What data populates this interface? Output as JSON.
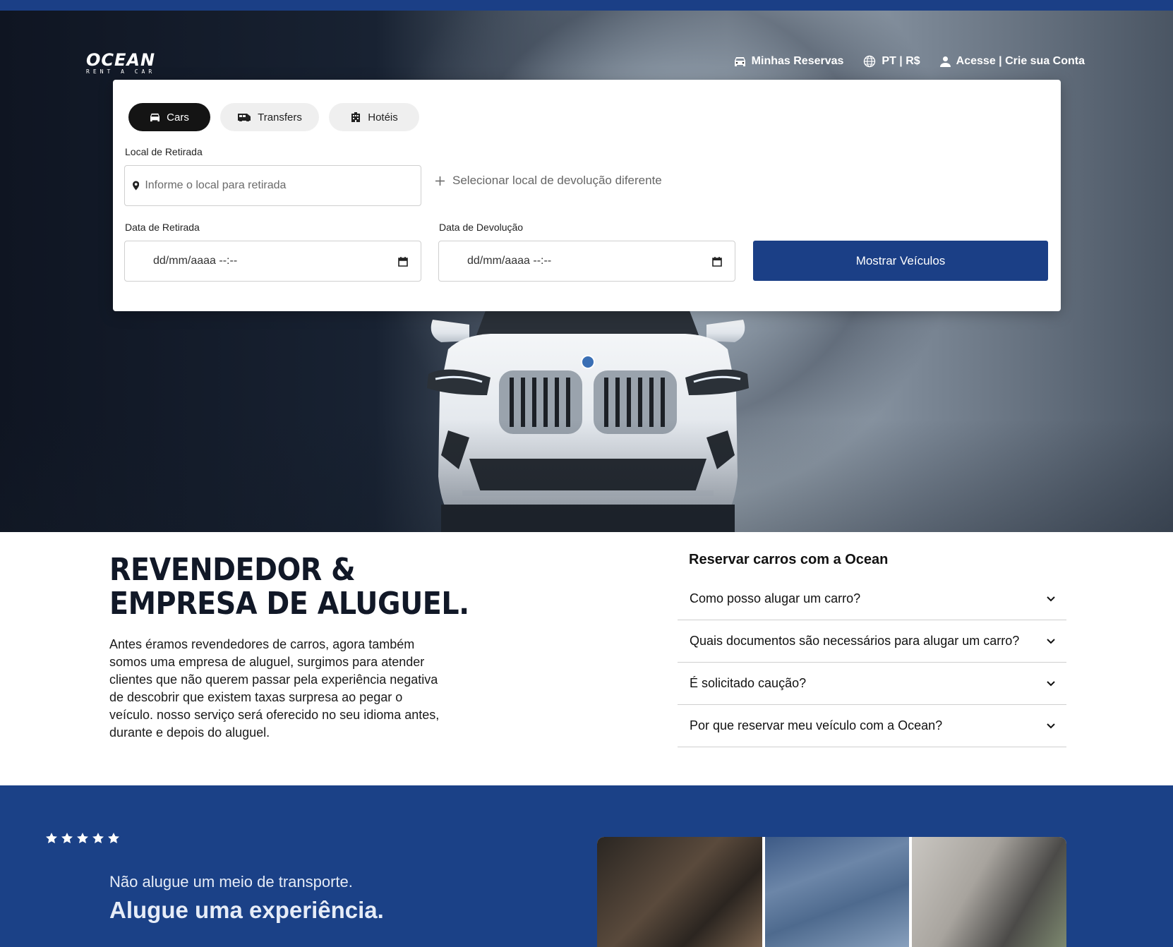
{
  "nav": {
    "brand": "OCEAN",
    "brand_sub": "RENT A CAR",
    "reservations": "Minhas Reservas",
    "language_currency": "PT | R$",
    "account": "Acesse | Crie sua Conta"
  },
  "search": {
    "tabs": [
      {
        "label": "Cars",
        "icon": "car-icon",
        "active": true
      },
      {
        "label": "Transfers",
        "icon": "van-icon",
        "active": false
      },
      {
        "label": "Hotéis",
        "icon": "hotel-icon",
        "active": false
      }
    ],
    "pickup_label": "Local de Retirada",
    "pickup_placeholder": "Informe o local para retirada",
    "different_return": "Selecionar local de devolução diferente",
    "pickup_date_label": "Data de Retirada",
    "pickup_date_value": "dd/mm/aaaa --:--",
    "return_date_label": "Data de Devolução",
    "return_date_value": "dd/mm/aaaa --:--",
    "submit": "Mostrar Veículos"
  },
  "about": {
    "heading_line1": "REVENDEDOR &",
    "heading_line2": "EMPRESA DE ALUGUEL.",
    "body": "Antes éramos revendedores de carros, agora também somos uma empresa de aluguel, surgimos para atender clientes que não querem passar pela experiência negativa de descobrir que existem taxas surpresa ao pegar o veículo. nosso serviço será oferecido no seu idioma antes, durante e depois do aluguel."
  },
  "faq": {
    "title": "Reservar carros com a Ocean",
    "items": [
      "Como posso alugar um carro?",
      "Quais documentos são necessários para alugar um carro?",
      "É solicitado caução?",
      "Por que reservar meu veículo com a Ocean?"
    ]
  },
  "promo": {
    "rating_stars": 5,
    "tagline_small": "Não alugue um meio de transporte.",
    "tagline_big": "Alugue uma experiência."
  },
  "colors": {
    "brand_blue": "#1b3f86",
    "promo_blue": "#1b4187",
    "active_tab": "#141414"
  }
}
